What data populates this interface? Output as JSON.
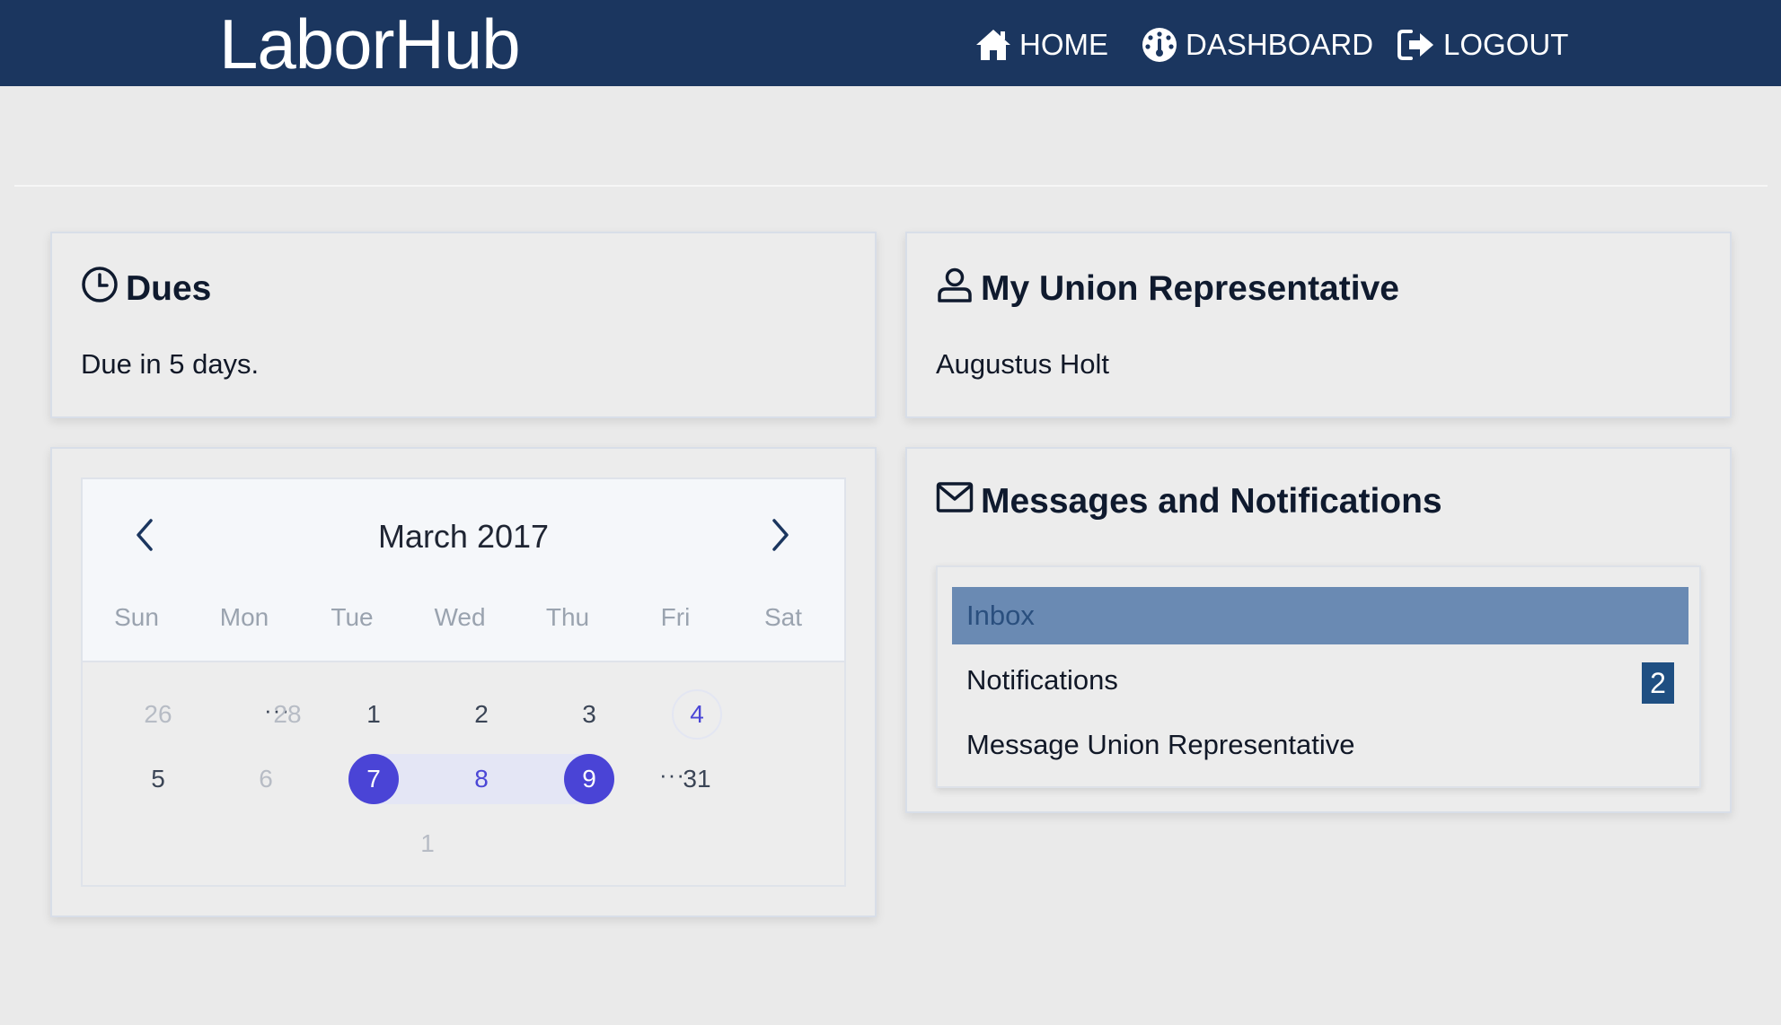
{
  "brand": "LaborHub",
  "nav": {
    "home": "HOME",
    "dashboard": "DASHBOARD",
    "logout": "LOGOUT"
  },
  "dues": {
    "title": "Dues",
    "text": "Due in 5 days."
  },
  "rep": {
    "title": "My Union Representative",
    "name": "Augustus Holt"
  },
  "calendar": {
    "month": "March 2017",
    "weekdays": [
      "Sun",
      "Mon",
      "Tue",
      "Wed",
      "Thu",
      "Fri",
      "Sat"
    ],
    "row1": [
      "26",
      "28",
      "1",
      "2",
      "3",
      "4"
    ],
    "row2": [
      "5",
      "6",
      "7",
      "8",
      "9",
      "31"
    ],
    "row3": [
      "1"
    ],
    "ellipsis": "···",
    "today": "4",
    "range_start": "7",
    "range_end": "9"
  },
  "messages": {
    "title": "Messages and Notifications",
    "items": [
      {
        "label": "Inbox",
        "active": true
      },
      {
        "label": "Notifications",
        "badge": "2"
      },
      {
        "label": "Message Union Representative"
      }
    ]
  },
  "colors": {
    "navbar": "#1b365f",
    "accent": "#4a44d6",
    "active_item": "#6a8ab3",
    "badge": "#1f4f82"
  }
}
